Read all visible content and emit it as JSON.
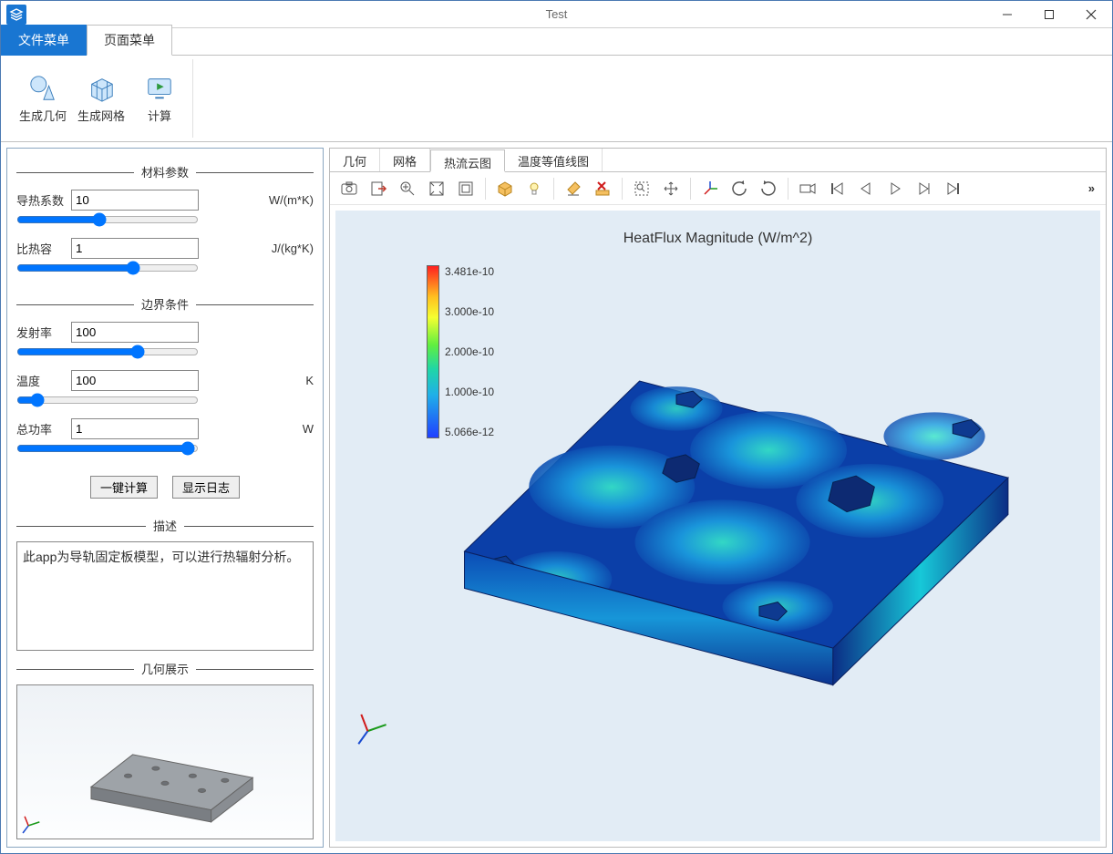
{
  "window": {
    "title": "Test"
  },
  "ribbon_tabs": {
    "file": "文件菜单",
    "page": "页面菜单"
  },
  "ribbon": {
    "gen_geom": "生成几何",
    "gen_mesh": "生成网格",
    "compute": "计算"
  },
  "sidebar": {
    "section_material": "材料参数",
    "section_bc": "边界条件",
    "section_desc": "描述",
    "section_geom": "几何展示",
    "thermal_cond": {
      "label": "导热系数",
      "value": "10",
      "unit": "W/(m*K)"
    },
    "spec_heat": {
      "label": "比热容",
      "value": "1",
      "unit": "J/(kg*K)"
    },
    "emissivity": {
      "label": "发射率",
      "value": "100"
    },
    "temperature": {
      "label": "温度",
      "value": "100",
      "unit": "K"
    },
    "total_power": {
      "label": "总功率",
      "value": "1",
      "unit": "W"
    },
    "btn_compute": "一键计算",
    "btn_log": "显示日志",
    "description": "此app为导轨固定板模型，可以进行热辐射分析。"
  },
  "plot_tabs": {
    "geom": "几何",
    "mesh": "网格",
    "heatflux": "热流云图",
    "isotherm": "温度等值线图"
  },
  "plot": {
    "title": "HeatFlux Magnitude (W/m^2)",
    "colorbar": {
      "t0": "3.481e-10",
      "t1": "3.000e-10",
      "t2": "2.000e-10",
      "t3": "1.000e-10",
      "t4": "5.066e-12"
    }
  }
}
